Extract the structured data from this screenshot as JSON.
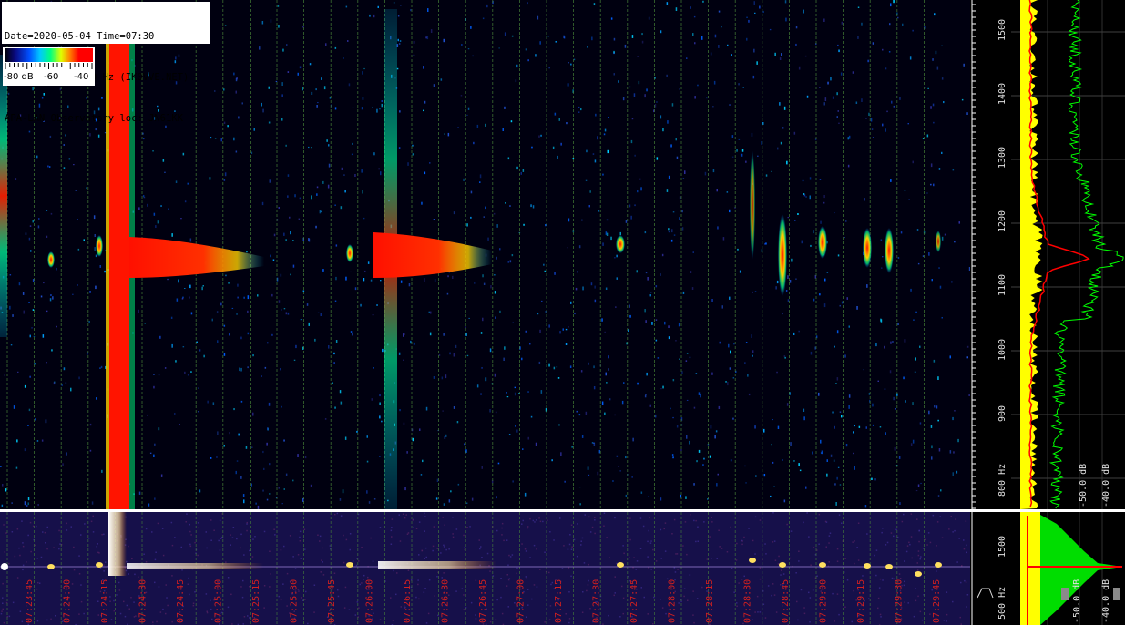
{
  "header": {
    "line1": "Date=2020-05-04 Time=07:30",
    "line2": "Freq= 750...1550 Hz (IK0VVE.NET)",
    "line3": "APA-LAN Observatory loc: JN61KK"
  },
  "legend": {
    "min_label": "-80 dB",
    "mid_label": "-60",
    "max_label": "-40"
  },
  "freq_axis": {
    "range_hz": [
      750,
      1550
    ],
    "ticks": [
      "1500",
      "1400",
      "1300",
      "1200",
      "1100",
      "1000",
      "900",
      "800 Hz"
    ]
  },
  "lower_freq_axis": {
    "ticks": [
      "1500",
      "500 Hz"
    ]
  },
  "level_axis": {
    "upper": [
      "-50.0 dB",
      "-40.0 dB"
    ],
    "lower": [
      "-50.0 dB",
      "-40.0 dB"
    ]
  },
  "time_axis": {
    "labels": [
      "07:23:45",
      "07:24:00",
      "07:24:15",
      "07:24:30",
      "07:24:45",
      "07:25:00",
      "07:25:15",
      "07:25:30",
      "07:25:45",
      "07:26:00",
      "07:26:15",
      "07:26:30",
      "07:26:45",
      "07:27:00",
      "07:27:15",
      "07:27:30",
      "07:27:45",
      "07:28:00",
      "07:28:15",
      "07:28:30",
      "07:28:45",
      "07:29:00",
      "07:29:15",
      "07:29:30",
      "07:29:45"
    ]
  },
  "colors": {
    "grid": "#4a8a3a",
    "time_label": "#d02020",
    "axis_text": "#e0e0e0",
    "yellow_trace": "#ffff00",
    "green_trace": "#00ff00",
    "red_trace": "#ff0000",
    "lower_bg": "#16104a"
  }
}
